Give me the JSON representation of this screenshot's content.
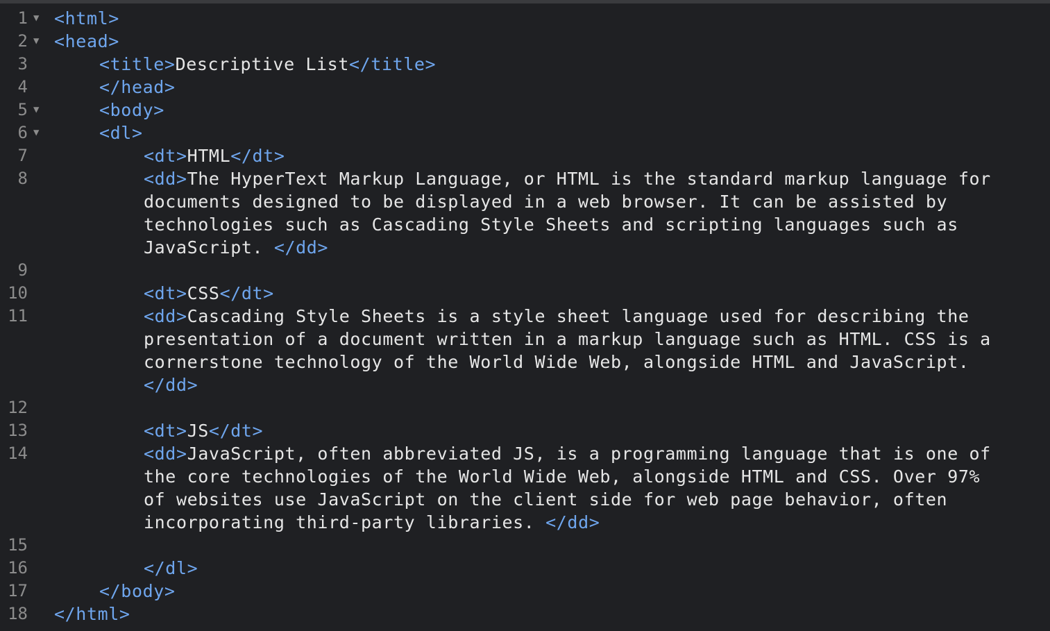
{
  "colors": {
    "background": "#1f2023",
    "tag": "#6fa6ee",
    "text": "#e6e6e6",
    "line_number": "#8c8c8c"
  },
  "fold_glyph": "▼",
  "lines": [
    {
      "num": "1",
      "fold": true,
      "tokens": [
        {
          "t": "tag",
          "v": "<html>"
        }
      ]
    },
    {
      "num": "2",
      "fold": true,
      "tokens": [
        {
          "t": "tag",
          "v": "<head>"
        }
      ]
    },
    {
      "num": "3",
      "fold": false,
      "tokens": [
        {
          "t": "tag",
          "v": "<title>"
        },
        {
          "t": "txt",
          "v": "Descriptive List"
        },
        {
          "t": "tag",
          "v": "</title>"
        }
      ]
    },
    {
      "num": "4",
      "fold": false,
      "tokens": [
        {
          "t": "tag",
          "v": "</head>"
        }
      ]
    },
    {
      "num": "5",
      "fold": true,
      "tokens": [
        {
          "t": "tag",
          "v": "<body>"
        }
      ]
    },
    {
      "num": "6",
      "fold": true,
      "tokens": [
        {
          "t": "tag",
          "v": "<dl>"
        }
      ]
    },
    {
      "num": "7",
      "fold": false,
      "tokens": [
        {
          "t": "tag",
          "v": "<dt>"
        },
        {
          "t": "txt",
          "v": "HTML"
        },
        {
          "t": "tag",
          "v": "</dt>"
        }
      ]
    },
    {
      "num": "8",
      "fold": false,
      "tokens": [
        {
          "t": "tag",
          "v": "<dd>"
        },
        {
          "t": "txt",
          "v": "The HyperText Markup Language, or HTML is the standard markup language for"
        }
      ]
    },
    {
      "num": "",
      "fold": false,
      "tokens": [
        {
          "t": "txt",
          "v": "documents designed to be displayed in a web browser. It can be assisted by"
        }
      ]
    },
    {
      "num": "",
      "fold": false,
      "tokens": [
        {
          "t": "txt",
          "v": "technologies such as Cascading Style Sheets and scripting languages such as"
        }
      ]
    },
    {
      "num": "",
      "fold": false,
      "tokens": [
        {
          "t": "txt",
          "v": "JavaScript. "
        },
        {
          "t": "tag",
          "v": "</dd>"
        }
      ]
    },
    {
      "num": "9",
      "fold": false,
      "tokens": []
    },
    {
      "num": "10",
      "fold": false,
      "tokens": [
        {
          "t": "tag",
          "v": "<dt>"
        },
        {
          "t": "txt",
          "v": "CSS"
        },
        {
          "t": "tag",
          "v": "</dt>"
        }
      ]
    },
    {
      "num": "11",
      "fold": false,
      "tokens": [
        {
          "t": "tag",
          "v": "<dd>"
        },
        {
          "t": "txt",
          "v": "Cascading Style Sheets is a style sheet language used for describing the"
        }
      ]
    },
    {
      "num": "",
      "fold": false,
      "tokens": [
        {
          "t": "txt",
          "v": "presentation of a document written in a markup language such as HTML. CSS is a"
        }
      ]
    },
    {
      "num": "",
      "fold": false,
      "tokens": [
        {
          "t": "txt",
          "v": "cornerstone technology of the World Wide Web, alongside HTML and JavaScript."
        }
      ]
    },
    {
      "num": "",
      "fold": false,
      "tokens": [
        {
          "t": "tag",
          "v": "</dd>"
        }
      ]
    },
    {
      "num": "12",
      "fold": false,
      "tokens": []
    },
    {
      "num": "13",
      "fold": false,
      "tokens": [
        {
          "t": "tag",
          "v": "<dt>"
        },
        {
          "t": "txt",
          "v": "JS"
        },
        {
          "t": "tag",
          "v": "</dt>"
        }
      ]
    },
    {
      "num": "14",
      "fold": false,
      "tokens": [
        {
          "t": "tag",
          "v": "<dd>"
        },
        {
          "t": "txt",
          "v": "JavaScript, often abbreviated JS, is a programming language that is one of"
        }
      ]
    },
    {
      "num": "",
      "fold": false,
      "tokens": [
        {
          "t": "txt",
          "v": "the core technologies of the World Wide Web, alongside HTML and CSS. Over 97%"
        }
      ]
    },
    {
      "num": "",
      "fold": false,
      "tokens": [
        {
          "t": "txt",
          "v": "of websites use JavaScript on the client side for web page behavior, often"
        }
      ]
    },
    {
      "num": "",
      "fold": false,
      "tokens": [
        {
          "t": "txt",
          "v": "incorporating third-party libraries. "
        },
        {
          "t": "tag",
          "v": "</dd>"
        }
      ]
    },
    {
      "num": "15",
      "fold": false,
      "tokens": []
    },
    {
      "num": "16",
      "fold": false,
      "tokens": [
        {
          "t": "tag",
          "v": "</dl>"
        }
      ]
    },
    {
      "num": "17",
      "fold": false,
      "tokens": [
        {
          "t": "tag",
          "v": "</body>"
        }
      ]
    },
    {
      "num": "18",
      "fold": false,
      "tokens": [
        {
          "t": "tag",
          "v": "</html>"
        }
      ]
    }
  ]
}
